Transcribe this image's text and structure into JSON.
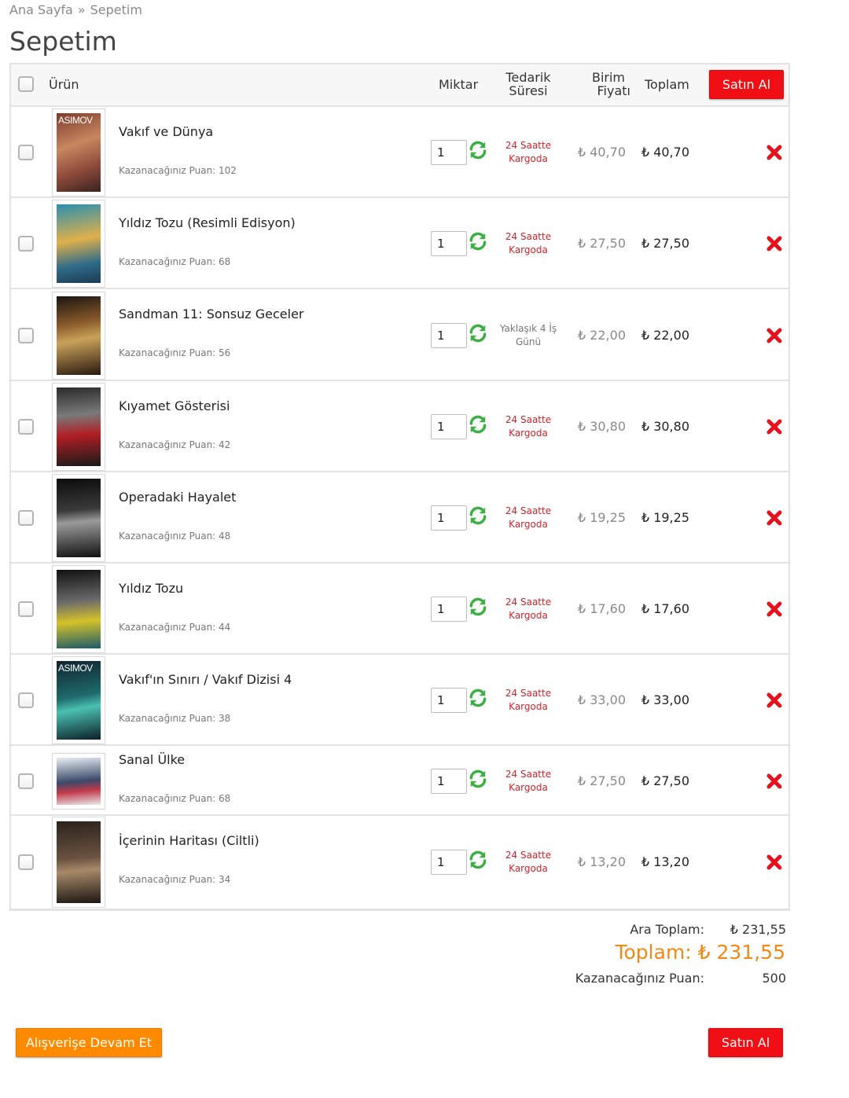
{
  "breadcrumb": {
    "home": "Ana Sayfa",
    "separator": "»",
    "current": "Sepetim"
  },
  "page_title": "Sepetim",
  "table_header": {
    "product": "Ürün",
    "quantity": "Miktar",
    "supply_line1": "Tedarik",
    "supply_line2": "Süresi",
    "unit_line1": "Birim",
    "unit_line2": "Fiyatı",
    "total": "Toplam",
    "buy_button": "Satın Al"
  },
  "items": [
    {
      "name": "Vakıf ve Dünya",
      "points": "Kazanacağınız Puan: 102",
      "qty": "1",
      "ship1": "24 Saatte",
      "ship2": "Kargoda",
      "unit": "₺ 40,70",
      "total": "₺ 40,70",
      "cover": "ASIMOV"
    },
    {
      "name": "Yıldız Tozu (Resimli Edisyon)",
      "points": "Kazanacağınız Puan: 68",
      "qty": "1",
      "ship1": "24 Saatte",
      "ship2": "Kargoda",
      "unit": "₺ 27,50",
      "total": "₺ 27,50",
      "cover": ""
    },
    {
      "name": "Sandman 11: Sonsuz Geceler",
      "points": "Kazanacağınız Puan: 56",
      "qty": "1",
      "ship1": "Yaklaşık 4 İş",
      "ship2": "Günü",
      "unit": "₺ 22,00",
      "total": "₺ 22,00",
      "cover": ""
    },
    {
      "name": "Kıyamet Gösterisi",
      "points": "Kazanacağınız Puan: 42",
      "qty": "1",
      "ship1": "24 Saatte",
      "ship2": "Kargoda",
      "unit": "₺ 30,80",
      "total": "₺ 30,80",
      "cover": ""
    },
    {
      "name": "Operadaki Hayalet",
      "points": "Kazanacağınız Puan: 48",
      "qty": "1",
      "ship1": "24 Saatte",
      "ship2": "Kargoda",
      "unit": "₺ 19,25",
      "total": "₺ 19,25",
      "cover": ""
    },
    {
      "name": "Yıldız Tozu",
      "points": "Kazanacağınız Puan: 44",
      "qty": "1",
      "ship1": "24 Saatte",
      "ship2": "Kargoda",
      "unit": "₺ 17,60",
      "total": "₺ 17,60",
      "cover": ""
    },
    {
      "name": "Vakıf'ın Sınırı / Vakıf Dizisi 4",
      "points": "Kazanacağınız Puan: 38",
      "qty": "1",
      "ship1": "24 Saatte",
      "ship2": "Kargoda",
      "unit": "₺ 33,00",
      "total": "₺ 33,00",
      "cover": "ASIMOV"
    },
    {
      "name": "Sanal Ülke",
      "points": "Kazanacağınız Puan: 68",
      "qty": "1",
      "ship1": "24 Saatte",
      "ship2": "Kargoda",
      "unit": "₺ 27,50",
      "total": "₺ 27,50",
      "cover": ""
    },
    {
      "name": "İçerinin Haritası (Ciltli)",
      "points": "Kazanacağınız Puan: 34",
      "qty": "1",
      "ship1": "24 Saatte",
      "ship2": "Kargoda",
      "unit": "₺ 13,20",
      "total": "₺ 13,20",
      "cover": ""
    }
  ],
  "summary": {
    "subtotal_label": "Ara Toplam:",
    "subtotal_value": "₺ 231,55",
    "grand_total": "Toplam: ₺ 231,55",
    "points_label": "Kazanacağınız Puan:",
    "points_value": "500"
  },
  "footer": {
    "continue_button": "Alışverişe Devam Et",
    "buy_button": "Satın Al"
  },
  "colors": {
    "buy_red": "#ef0f14",
    "continue_orange": "#ff8a00",
    "total_orange": "#f08a16",
    "shipping_red": "#c8252c",
    "refresh_green": "#3cb043"
  },
  "icons": {
    "refresh": "refresh-icon",
    "delete": "delete-x-icon"
  }
}
